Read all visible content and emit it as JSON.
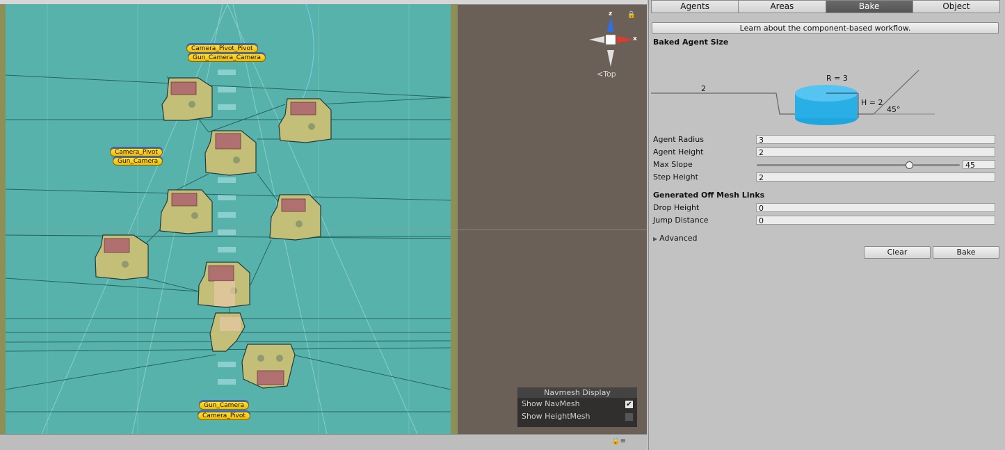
{
  "tabs": [
    {
      "label": "Agents",
      "active": false
    },
    {
      "label": "Areas",
      "active": false
    },
    {
      "label": "Bake",
      "active": true
    },
    {
      "label": "Object",
      "active": false
    }
  ],
  "learn_button": "Learn about the component-based workflow.",
  "baked_agent_size": {
    "title": "Baked Agent Size",
    "diagram": {
      "step_label": "2",
      "radius_label": "R = 3",
      "height_label": "H = 2",
      "slope_label": "45°"
    }
  },
  "properties": {
    "agent_radius": {
      "label": "Agent Radius",
      "value": "3"
    },
    "agent_height": {
      "label": "Agent Height",
      "value": "2"
    },
    "max_slope": {
      "label": "Max Slope",
      "value": "45",
      "slider_fraction": 0.75
    },
    "step_height": {
      "label": "Step Height",
      "value": "2"
    }
  },
  "off_mesh_links": {
    "title": "Generated Off Mesh Links",
    "drop_height": {
      "label": "Drop Height",
      "value": "0"
    },
    "jump_distance": {
      "label": "Jump Distance",
      "value": "0"
    }
  },
  "advanced_label": "Advanced",
  "buttons": {
    "clear": "Clear",
    "bake": "Bake"
  },
  "scene": {
    "orientation": {
      "label": "Top",
      "axis_z": "z",
      "axis_x": "x"
    },
    "gizmo_labels": [
      {
        "text": "Camera_Pivot_Pivot"
      },
      {
        "text": "Gun_Camera_Camera"
      },
      {
        "text": "Camera_Pivot"
      },
      {
        "text": "Gun_Camera"
      },
      {
        "text": "Gun_Camera"
      },
      {
        "text": "Camera_Pivot"
      }
    ],
    "navmesh_display": {
      "title": "Navmesh Display",
      "show_navmesh": {
        "label": "Show NavMesh",
        "checked": true
      },
      "show_heightmesh": {
        "label": "Show HeightMesh",
        "checked": false
      }
    }
  },
  "colors": {
    "accent_tab": "#5a5a5a",
    "navmesh": "#58b2ac",
    "agent_cylinder": "#29aee6",
    "gizmo_label": "#f5c400"
  }
}
